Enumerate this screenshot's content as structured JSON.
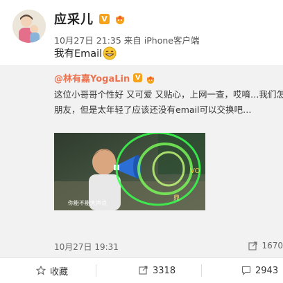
{
  "post": {
    "username": "应采儿",
    "verified_badge": "V",
    "meta_time": "10月27日 21:35",
    "meta_from": "来自 iPhone客户端",
    "text": "我有Email",
    "emoji": "grinning-face"
  },
  "repost": {
    "username": "@林有嘉YogaLin",
    "verified_badge": "V",
    "line1": "这位小哥哥个性好 又可爱 又贴心，上网一查，哎唷…我们怎麽隐",
    "line2": "朋友，但是太年轻了应该还没有email可以交换吧…",
    "video_caption": "你能不能大声点",
    "date": "10月27日 19:31",
    "share_count": "1670"
  },
  "actions": {
    "favorite_label": "收藏",
    "repost_count": "3318",
    "comment_count": "2943"
  },
  "colors": {
    "link": "#eb7350",
    "badge": "#f7a21b",
    "repost_bg": "#f2f2f2"
  }
}
